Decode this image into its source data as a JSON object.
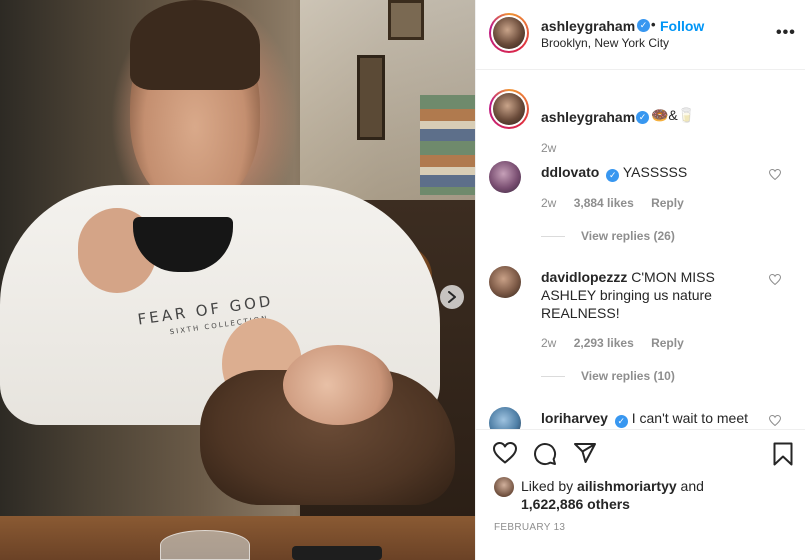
{
  "post": {
    "username": "ashleygraham",
    "dot": "•",
    "follow_label": "Follow",
    "location": "Brooklyn, New York City",
    "more_label": "•••",
    "caption_text": "🍩&🥛",
    "caption_time": "2w",
    "photo_text": "FEAR OF GOD",
    "photo_subtext": "SIXTH COLLECTION"
  },
  "comments": [
    {
      "username": "ddlovato",
      "text": "YASSSSS",
      "time": "2w",
      "likes": "3,884 likes",
      "reply": "Reply",
      "view_replies": "View replies (26)"
    },
    {
      "username": "davidlopezzz",
      "text": "C'MON MISS ASHLEY bringing us nature REALNESS!",
      "time": "2w",
      "likes": "2,293 likes",
      "reply": "Reply",
      "view_replies": "View replies (10)"
    },
    {
      "username": "loriharvey",
      "text": "I can't wait to meet"
    }
  ],
  "likes": {
    "liked_by_prefix": "Liked by",
    "liked_by_user": "ailishmoriartyy",
    "and": "and",
    "others": "1,622,886 others"
  },
  "date": "FEBRUARY 13",
  "icons": {
    "verified": "verified-badge-icon",
    "heart": "heart-icon",
    "comment": "comment-icon",
    "share": "share-icon",
    "save": "bookmark-icon",
    "next": "chevron-right-icon"
  },
  "colors": {
    "link": "#0095f6",
    "verified": "#3897f0",
    "muted": "#8e8e8e"
  }
}
